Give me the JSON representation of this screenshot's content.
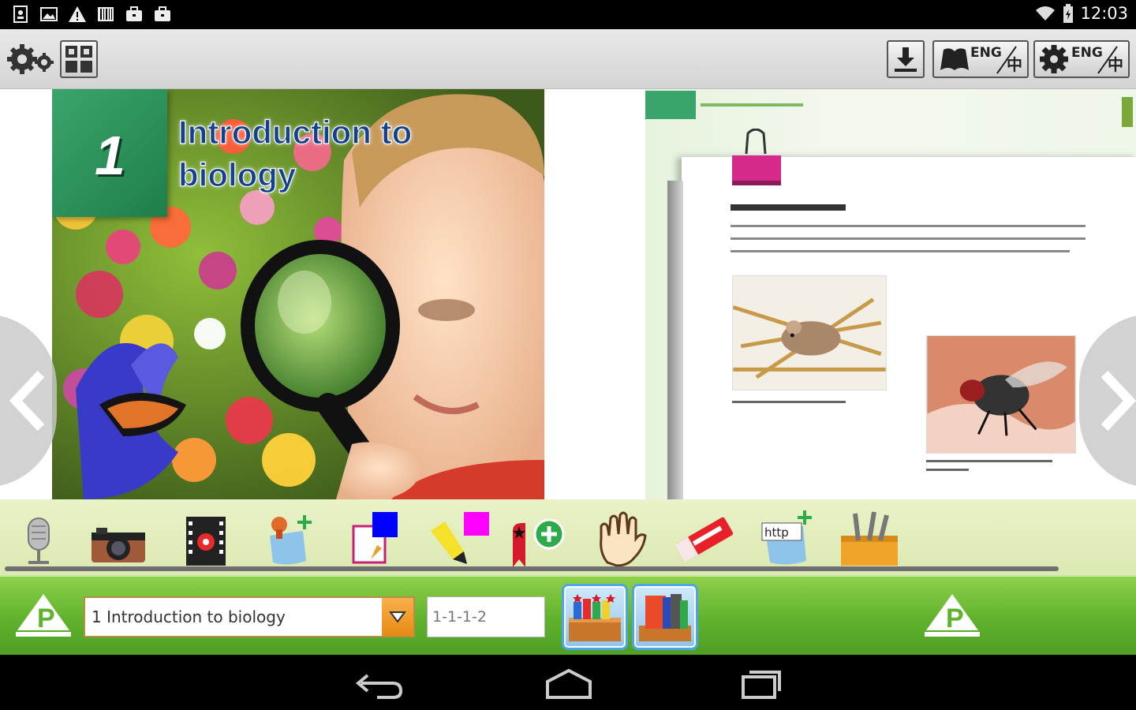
{
  "status_bar": {
    "time": "12:03",
    "notification_icons": [
      "portrait-icon",
      "image-icon",
      "warning-icon",
      "barcode-icon",
      "briefcase-icon",
      "briefcase-icon"
    ]
  },
  "toolbar": {
    "lang_label_1": "ENG",
    "lang_label_2": "ENG",
    "chinese_char_1": "中",
    "chinese_char_2": "中"
  },
  "book": {
    "chapter_number": "1",
    "chapter_title_line1": "Introduction to",
    "chapter_title_line2": "biology"
  },
  "bottom_bar": {
    "chapter_select_value": "1 Introduction to biology",
    "page_placeholder": "1-1-1-2"
  },
  "colors": {
    "accent_green": "#5fb22c",
    "select_orange": "#e88a14",
    "title_blue": "#13408f",
    "shelf_blue": "#4aa6e8"
  }
}
